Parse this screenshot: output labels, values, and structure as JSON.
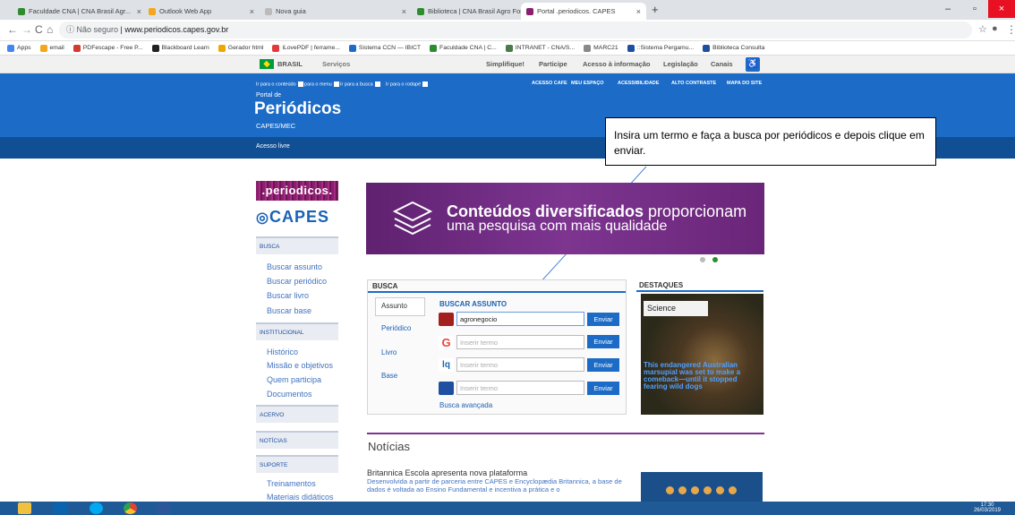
{
  "browser": {
    "tabs": [
      {
        "title": "Faculdade CNA | CNA Brasil Agr...",
        "favicon_color": "#2e8b2e"
      },
      {
        "title": "Outlook Web App",
        "favicon_color": "#f4a61e"
      },
      {
        "title": "Nova guia",
        "favicon_color": "#bbbbbb"
      },
      {
        "title": "Biblioteca | CNA Brasil Agro For...",
        "favicon_color": "#2e8b2e"
      },
      {
        "title": "Portal .periodicos. CAPES",
        "favicon_color": "#8a1f6d"
      }
    ],
    "new_tab": "+",
    "url_security": "ⓘ Não seguro",
    "url": "www.periodicos.capes.gov.br",
    "bookmarks": [
      {
        "label": "Apps",
        "color": "#4285f4"
      },
      {
        "label": "email",
        "color": "#f4a61e"
      },
      {
        "label": "PDFescape - Free P...",
        "color": "#d23b2f"
      },
      {
        "label": "Blackboard Learn",
        "color": "#222222"
      },
      {
        "label": "Gerador html",
        "color": "#f0a500"
      },
      {
        "label": "iLovePDF | ferrame...",
        "color": "#e33b3b"
      },
      {
        "label": "Sistema CCN — IBICT",
        "color": "#1c6bc7"
      },
      {
        "label": "Faculdade CNA | C...",
        "color": "#2e8b2e"
      },
      {
        "label": "INTRANET - CNA/S...",
        "color": "#4a7a4a"
      },
      {
        "label": "MARC21",
        "color": "#888888"
      },
      {
        "label": "::Sistema Pergamu...",
        "color": "#1c4fa0"
      },
      {
        "label": "Biblioteca Consulta",
        "color": "#1c4fa0"
      }
    ]
  },
  "gov_bar": {
    "brasil": "BRASIL",
    "servicos": "Serviços",
    "links": [
      "Simplifique!",
      "Participe",
      "Acesso à informação",
      "Legislação",
      "Canais"
    ]
  },
  "header": {
    "skip_links": [
      "Ir para o conteúdo",
      "Ir para o menu",
      "Ir para a busca",
      "Ir para o rodapé"
    ],
    "top_links": [
      "ACESSO CAFE",
      "MEU ESPAÇO",
      "ACESSIBILIDADE",
      "ALTO CONTRASTE",
      "MAPA DO SITE"
    ],
    "portal_de": "Portal de",
    "title": "Periódicos",
    "subtitle": "CAPES/MEC",
    "access": "Acesso livre"
  },
  "callout": "Insira um termo e faça a busca por periódicos e depois clique em enviar.",
  "sidebar": {
    "logo_text": ".periodicos.",
    "capes_logo": "CAPES",
    "busca_header": "BUSCA",
    "busca_links": [
      "Buscar assunto",
      "Buscar periódico",
      "Buscar livro",
      "Buscar base"
    ],
    "institucional_header": "INSTITUCIONAL",
    "institucional_links": [
      "Histórico",
      "Missão e objetivos",
      "Quem participa",
      "Documentos"
    ],
    "acervo_header": "ACERVO",
    "noticias_header": "NOTÍCIAS",
    "suporte_header": "SUPORTE",
    "suporte_links": [
      "Treinamentos",
      "Materiais didáticos"
    ]
  },
  "banner": {
    "line1_bold": "Conteúdos diversificados",
    "line1_rest": " proporcionam",
    "line2": "uma pesquisa com mais qualidade"
  },
  "busca": {
    "title": "BUSCA",
    "tabs": [
      "Assunto",
      "Periódico",
      "Livro",
      "Base"
    ],
    "subtitle": "BUSCAR ASSUNTO",
    "query_value": "agronegocio",
    "placeholder": "Inserir termo",
    "send": "Enviar",
    "advanced": "Busca avançada"
  },
  "destaques": {
    "title": "DESTAQUES",
    "label": "Science",
    "caption": "This endangered Australian marsupial was set to make a comeback—until it stopped fearing wild dogs"
  },
  "noticias": {
    "title": "Notícias",
    "headline": "Britannica Escola apresenta nova plataforma",
    "body": "Desenvolvida a partir de parceria entre CAPES e Encyclopædia Britannica, a base de dados é voltada ao Ensino Fundamental e incentiva a prática e o"
  },
  "taskbar": {
    "time": "17:30",
    "date": "26/03/2019",
    "apps": [
      {
        "name": "explorer",
        "color": "#f0c040"
      },
      {
        "name": "outlook",
        "color": "#0a64ad"
      },
      {
        "name": "skype",
        "color": "#00a9f0"
      },
      {
        "name": "chrome",
        "color": "#e34133"
      },
      {
        "name": "word",
        "color": "#2b579a"
      }
    ]
  }
}
